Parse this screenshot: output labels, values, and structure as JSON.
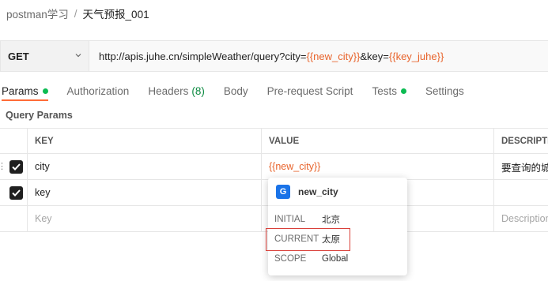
{
  "breadcrumb": {
    "parent": "postman学习",
    "separator": "/",
    "current": "天气预报_001"
  },
  "request": {
    "method": "GET",
    "url_parts": [
      {
        "text": "http://apis.juhe.cn/simpleWeather/query?city=",
        "var": false
      },
      {
        "text": "{{new_city}}",
        "var": true
      },
      {
        "text": "&key=",
        "var": false
      },
      {
        "text": "{{key_juhe}}",
        "var": true
      }
    ]
  },
  "tabs": [
    {
      "label": "Params",
      "dot": true,
      "active": true
    },
    {
      "label": "Authorization"
    },
    {
      "label": "Headers",
      "count": "(8)"
    },
    {
      "label": "Body"
    },
    {
      "label": "Pre-request Script"
    },
    {
      "label": "Tests",
      "dot": true
    },
    {
      "label": "Settings"
    }
  ],
  "query_params": {
    "title": "Query Params",
    "headers": {
      "key": "KEY",
      "value": "VALUE",
      "description": "DESCRIPTI"
    },
    "rows": [
      {
        "checked": true,
        "key": "city",
        "value": "{{new_city}}",
        "description": "要查询的城"
      },
      {
        "checked": true,
        "key": "key",
        "value": "",
        "description": ""
      }
    ],
    "placeholder": {
      "key": "Key",
      "description": "Description"
    }
  },
  "variable_popover": {
    "badge": "G",
    "name": "new_city",
    "initial_label": "INITIAL",
    "initial_value": "北京",
    "current_label": "CURRENT",
    "current_value": "太原",
    "scope_label": "SCOPE",
    "scope_value": "Global"
  },
  "colors": {
    "accent": "#ff6c37",
    "variable": "#e8632b",
    "status_dot": "#0cbb52",
    "highlight_box": "#d9403a",
    "global_badge": "#1a73e8"
  }
}
